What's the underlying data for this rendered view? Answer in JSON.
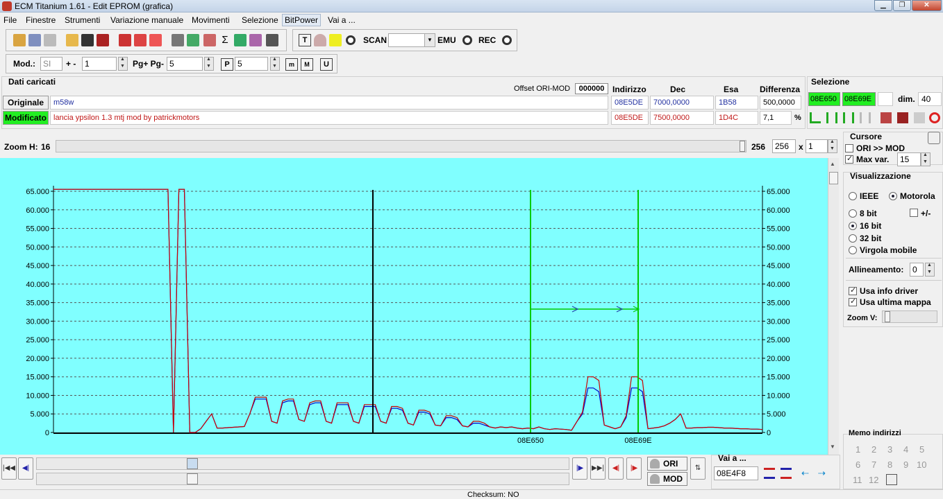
{
  "window": {
    "title": "ECM Titanium 1.61 - Edit EPROM (grafica)"
  },
  "menu": [
    "File",
    "Finestre",
    "Strumenti",
    "Variazione manuale",
    "Movimenti",
    "Selezione",
    "BitPower",
    "Vai a ..."
  ],
  "toolbar1": {
    "scan_label": "SCAN",
    "emu_label": "EMU",
    "rec_label": "REC",
    "scan_value": ""
  },
  "toolbar2": {
    "mod_label": "Mod.:",
    "mod_value": "SI",
    "plusminus_label": "+ -",
    "plusminus_value": "1",
    "pg_label": "Pg+ Pg-",
    "pg_value": "5",
    "p_value": "5",
    "btn_m": "m",
    "btn_M": "M",
    "btn_U": "U"
  },
  "dati": {
    "header": "Dati caricati",
    "offset_label": "Offset ORI-MOD",
    "offset_value": "000000",
    "col_indirizzo": "Indirizzo",
    "col_dec": "Dec",
    "col_esa": "Esa",
    "col_diff": "Differenza",
    "originale_label": "Originale",
    "originale_name": "m58w",
    "originale_addr": "08E5DE",
    "originale_dec": "7000,0000",
    "originale_esa": "1B58",
    "originale_diff": "500,0000",
    "modificato_label": "Modificato",
    "modificato_name": "lancia ypsilon 1.3 mtj mod by patrickmotors",
    "modificato_addr": "08E5DE",
    "modificato_dec": "7500,0000",
    "modificato_esa": "1D4C",
    "modificato_diff": "7,1",
    "percent": "%"
  },
  "selezione": {
    "title": "Selezione",
    "start": "08E650",
    "end": "08E69E",
    "extra": "",
    "dim_label": "dim.",
    "dim_value": "40"
  },
  "zoom": {
    "label": "Zoom H:",
    "value": "16",
    "width_value": "256",
    "width_field": "256",
    "x_label": "x",
    "mult": "1"
  },
  "cursore": {
    "title": "Cursore",
    "ori_mod_label": "ORI >> MOD",
    "ori_mod_checked": false,
    "maxvar_label": "Max var.",
    "maxvar_checked": true,
    "maxvar_value": "15"
  },
  "visualizzazione": {
    "title": "Visualizzazione",
    "ieee": "IEEE",
    "motorola": "Motorola",
    "bit8": "8 bit",
    "plusminus": "+/-",
    "bit16": "16 bit",
    "bit32": "32 bit",
    "virgola": "Virgola mobile",
    "allineamento_label": "Allineamento:",
    "allineamento_value": "0",
    "usa_info": "Usa info driver",
    "usa_ultima": "Usa ultima mappa",
    "zoomv_label": "Zoom V:"
  },
  "memo": {
    "title": "Memo indirizzi",
    "items": [
      "1",
      "2",
      "3",
      "4",
      "5",
      "6",
      "7",
      "8",
      "9",
      "10",
      "11",
      "12"
    ]
  },
  "bottom": {
    "ori_label": "ORI",
    "mod_label": "MOD",
    "vai_label": "Vai a ...",
    "vai_value": "08E4F8"
  },
  "status": {
    "checksum": "Checksum: NO"
  },
  "colors": {
    "chart_bg": "#80ffff",
    "ori_line": "#0000cc",
    "mod_line": "#cc0000",
    "cursor": "#000000",
    "selection": "#00cc00"
  },
  "chart_data": {
    "type": "line",
    "ylim": [
      0,
      65000
    ],
    "y_ticks": [
      "65.000",
      "60.000",
      "55.000",
      "50.000",
      "45.000",
      "40.000",
      "35.000",
      "30.000",
      "25.000",
      "20.000",
      "15.000",
      "10.000",
      "5.000",
      "0"
    ],
    "x_ticks": [
      "08E650",
      "08E69E"
    ],
    "series": [
      {
        "values": [
          65535,
          65535,
          65535,
          65535,
          65535,
          65535,
          65535,
          65535,
          65535,
          65535,
          65535,
          65535,
          65535,
          65535,
          65535,
          65535,
          65535,
          65535,
          65535,
          65535,
          65535,
          65535,
          0,
          65535,
          65535,
          0,
          0,
          1000,
          3000,
          5000,
          1200,
          1200,
          1300,
          1400,
          1500,
          1600,
          5000,
          9000,
          9000,
          9000,
          3000,
          2500,
          8000,
          8500,
          8500,
          3500,
          3000,
          7500,
          8000,
          8000,
          3000,
          2500,
          7500,
          7500,
          7500,
          3000,
          2500,
          7000,
          7000,
          7000,
          3000,
          2500,
          6500,
          6500,
          6000,
          2500,
          2000,
          5500,
          5500,
          5000,
          2000,
          1800,
          4000,
          4000,
          3500,
          1800,
          1500,
          2500,
          2500,
          2000,
          1500,
          1200,
          1500,
          1300,
          1500,
          1200,
          1000,
          1200,
          1000,
          1500,
          1000,
          800,
          1000,
          900,
          800,
          600,
          3000,
          5000,
          12000,
          12000,
          11000,
          2000,
          1500,
          1000,
          1500,
          4000,
          12000,
          12000,
          11000,
          1000,
          1200,
          1400,
          1800,
          2500,
          3500,
          5000,
          1200,
          1200,
          1300,
          1300,
          1400,
          1400,
          1300,
          1200,
          1200,
          1100,
          1000,
          1000,
          900,
          900,
          800
        ]
      },
      {
        "values": [
          65535,
          65535,
          65535,
          65535,
          65535,
          65535,
          65535,
          65535,
          65535,
          65535,
          65535,
          65535,
          65535,
          65535,
          65535,
          65535,
          65535,
          65535,
          65535,
          65535,
          65535,
          65535,
          0,
          65535,
          65535,
          0,
          0,
          1000,
          3000,
          5000,
          1200,
          1200,
          1300,
          1400,
          1500,
          1600,
          5000,
          9500,
          9500,
          9500,
          3000,
          2500,
          8500,
          9000,
          9000,
          3500,
          3000,
          8000,
          8500,
          8500,
          3000,
          2500,
          8000,
          8000,
          8000,
          3000,
          2500,
          7500,
          7500,
          7500,
          3000,
          2500,
          7000,
          7000,
          6500,
          2500,
          2000,
          6000,
          6000,
          5500,
          2000,
          1800,
          4500,
          4500,
          4000,
          1800,
          1500,
          3000,
          3000,
          2500,
          1500,
          1200,
          1500,
          1300,
          1500,
          1200,
          1000,
          1200,
          1000,
          1500,
          1000,
          800,
          1000,
          900,
          800,
          600,
          3000,
          5500,
          15000,
          15000,
          14000,
          2000,
          1500,
          1000,
          1500,
          4500,
          15000,
          15000,
          14000,
          1000,
          1200,
          1400,
          1800,
          2500,
          3500,
          5000,
          1200,
          1200,
          1300,
          1300,
          1400,
          1400,
          1300,
          1200,
          1200,
          1100,
          1000,
          1000,
          900,
          900,
          800
        ]
      }
    ],
    "grid": true
  }
}
